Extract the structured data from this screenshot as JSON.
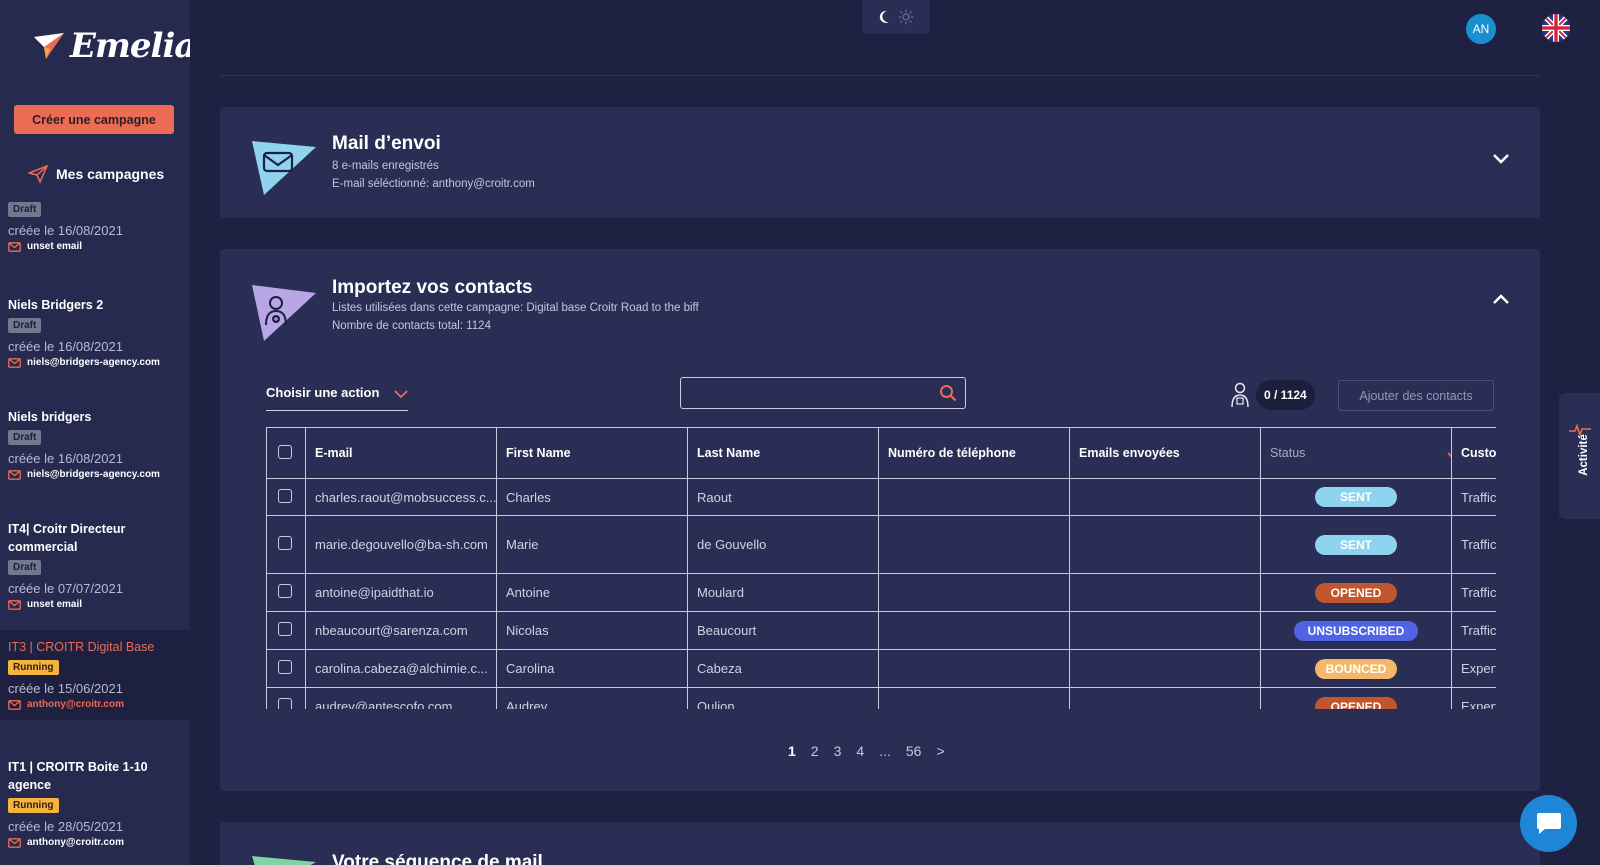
{
  "sidebar": {
    "logo_text": "Emelia",
    "create_button": "Créer une campagne",
    "my_campaigns": "Mes campagnes",
    "campaigns": [
      {
        "name": "",
        "badge": "Draft",
        "date": "créée le 16/08/2021",
        "email": "unset email",
        "active": false
      },
      {
        "name": "Niels Bridgers 2",
        "badge": "Draft",
        "date": "créée le 16/08/2021",
        "email": "niels@bridgers-agency.com",
        "active": false
      },
      {
        "name": "Niels bridgers",
        "badge": "Draft",
        "date": "créée le 16/08/2021",
        "email": "niels@bridgers-agency.com",
        "active": false
      },
      {
        "name": "IT4| Croitr Directeur commercial",
        "badge": "Draft",
        "date": "créée le 07/07/2021",
        "email": "unset email",
        "active": false
      },
      {
        "name": "IT3 | CROITR Digital Base",
        "badge": "Running",
        "date": "créée le 15/06/2021",
        "email": "anthony@croitr.com",
        "active": true
      },
      {
        "name": "IT1 | CROITR Boite 1-10 agence",
        "badge": "Running",
        "date": "créée le 28/05/2021",
        "email": "anthony@croitr.com",
        "active": false
      }
    ]
  },
  "header": {
    "avatar_initials": "AN",
    "language_icon": "uk-flag-icon"
  },
  "mail_card": {
    "title": "Mail d’envoi",
    "count_text": "8 e-mails enregistrés",
    "selected_text": "E-mail séléctionné: anthony@croitr.com"
  },
  "contacts_card": {
    "title": "Importez vos contacts",
    "lists_text": "Listes utilisées dans cette campagne: Digital base Croitr Road to the biff",
    "total_text": "Nombre de contacts total: 1124",
    "action_select": "Choisir une action",
    "search_placeholder": "",
    "selection_count": "0 / 1124",
    "add_button": "Ajouter des contacts",
    "columns": [
      "E-mail",
      "First Name",
      "Last Name",
      "Numéro de téléphone",
      "Emails envoyées",
      "Status",
      "Custom"
    ],
    "rows": [
      {
        "email": "charles.raout@mobsuccess.c...",
        "first": "Charles",
        "last": "Raout",
        "phone": "",
        "sent": "",
        "status": "SENT",
        "custom": "Traffic"
      },
      {
        "email": "marie.degouvello@ba-sh.com",
        "first": "Marie",
        "last": "de Gouvello",
        "phone": "",
        "sent": "",
        "status": "SENT",
        "custom": "Traffic"
      },
      {
        "email": "antoine@ipaidthat.io",
        "first": "Antoine",
        "last": "Moulard",
        "phone": "",
        "sent": "",
        "status": "OPENED",
        "custom": "Traffic"
      },
      {
        "email": "nbeaucourt@sarenza.com",
        "first": "Nicolas",
        "last": "Beaucourt",
        "phone": "",
        "sent": "",
        "status": "UNSUBSCRIBED",
        "custom": "Traffic"
      },
      {
        "email": "carolina.cabeza@alchimie.c...",
        "first": "Carolina",
        "last": "Cabeza",
        "phone": "",
        "sent": "",
        "status": "BOUNCED",
        "custom": "Expert"
      },
      {
        "email": "audrey@antescofo.com",
        "first": "Audrey",
        "last": "Oulion",
        "phone": "",
        "sent": "",
        "status": "OPENED",
        "custom": "Expert"
      }
    ],
    "pagination": [
      "1",
      "2",
      "3",
      "4",
      "...",
      "56",
      ">"
    ]
  },
  "sequence_card": {
    "title": "Votre séquence de mail"
  },
  "activity_tab": "Activité",
  "status_colors": {
    "SENT": "#8fd3ef",
    "OPENED": "#c0562d",
    "UNSUBSCRIBED": "#4f63e6",
    "BOUNCED": "#f5b86a"
  },
  "accent_color": "#ec6b53"
}
